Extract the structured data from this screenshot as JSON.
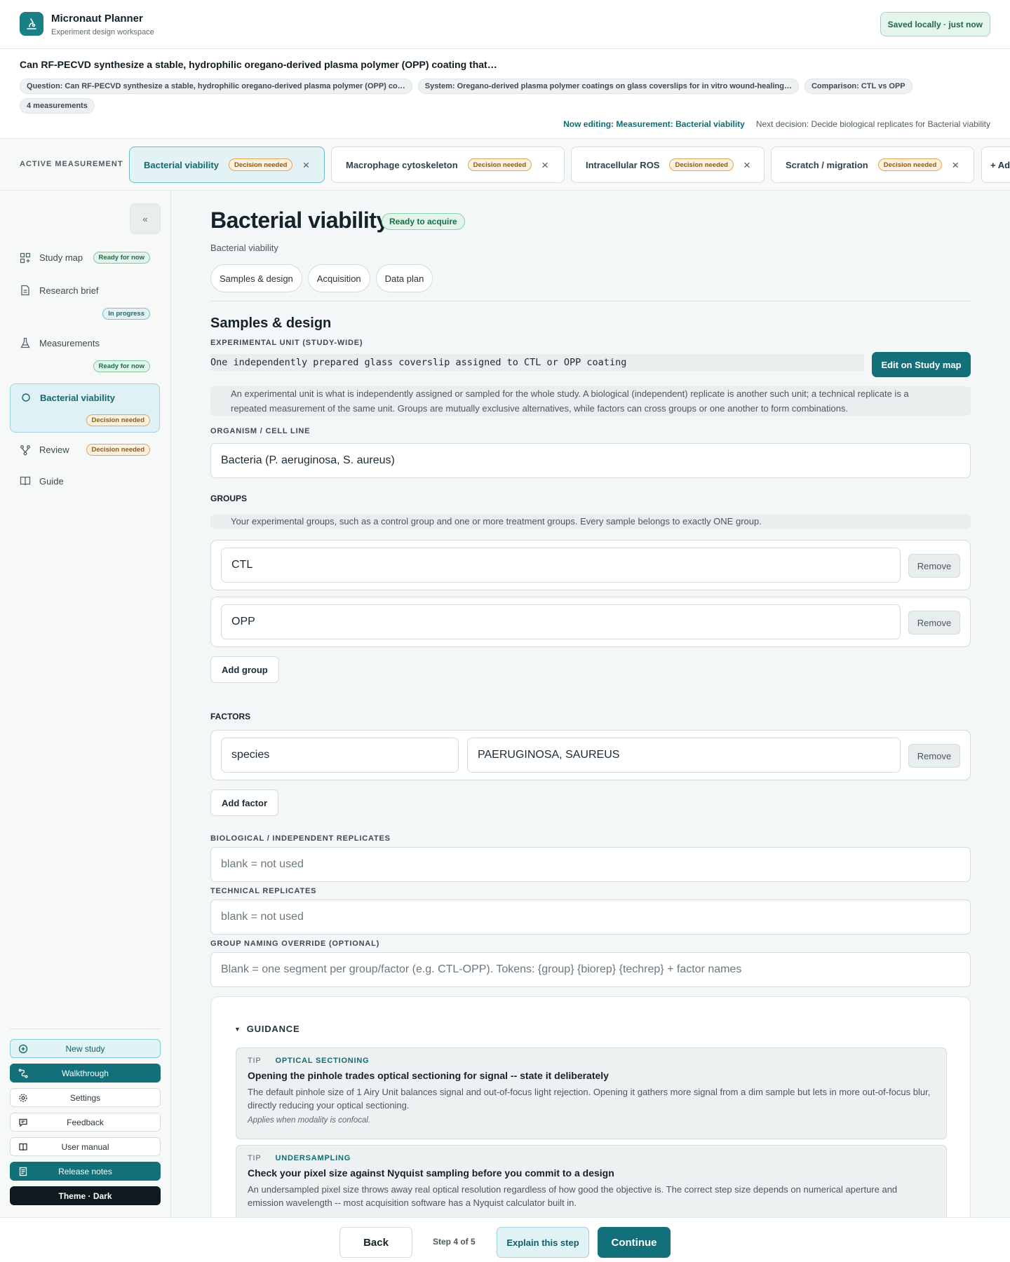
{
  "header": {
    "app_title": "Micronaut Planner",
    "app_subtitle": "Experiment design workspace",
    "saved_status": "Saved locally · just now"
  },
  "study": {
    "question": "Can RF-PECVD synthesize a stable, hydrophilic oregano-derived plasma polymer (OPP) coating that…",
    "chips": [
      "Question: Can RF-PECVD synthesize a stable, hydrophilic oregano-derived plasma polymer (OPP) co…",
      "System: Oregano-derived plasma polymer coatings on glass coverslips for in vitro wound-healing…",
      "Comparison: CTL vs OPP",
      "4 measurements"
    ],
    "now_editing": "Now editing: Measurement: Bacterial viability",
    "next_decision": "Next decision: Decide biological replicates for Bacterial viability"
  },
  "measurements_bar": {
    "label": "ACTIVE MEASUREMENT",
    "tabs": [
      {
        "label": "Bacterial viability",
        "badge": "Decision needed"
      },
      {
        "label": "Macrophage cytoskeleton",
        "badge": "Decision needed"
      },
      {
        "label": "Intracellular ROS",
        "badge": "Decision needed"
      },
      {
        "label": "Scratch / migration",
        "badge": "Decision needed"
      }
    ],
    "add_label": "+ Add"
  },
  "sidebar": {
    "collapse_label": "«",
    "items": [
      {
        "label": "Study map",
        "badge": "Ready for now",
        "icon": "grid-plus-icon"
      },
      {
        "label": "Research brief",
        "badge": "In progress",
        "icon": "document-icon"
      },
      {
        "label": "Measurements",
        "badge": "Ready for now",
        "icon": "flask-icon"
      },
      {
        "label": "Bacterial viability",
        "badge": "Decision needed",
        "icon": "circle-icon"
      },
      {
        "label": "Review",
        "badge": "Decision needed",
        "icon": "branch-icon"
      },
      {
        "label": "Guide",
        "icon": "book-icon"
      }
    ],
    "buttons": {
      "new_study": "New study",
      "walkthrough": "Walkthrough",
      "settings": "Settings",
      "feedback": "Feedback",
      "user_manual": "User manual",
      "release_notes": "Release notes",
      "theme": "Theme · Dark"
    }
  },
  "main": {
    "title": "Bacterial viability",
    "status_badge": "Ready to acquire",
    "subtitle": "Bacterial viability",
    "section_tabs": [
      "Samples & design",
      "Acquisition",
      "Data plan"
    ],
    "section_heading": "Samples & design",
    "experimental_unit": {
      "label": "EXPERIMENTAL UNIT (STUDY-WIDE)",
      "value": "One independently prepared glass coverslip assigned to CTL or OPP coating",
      "edit_button": "Edit on Study map",
      "help": "An experimental unit is what is independently assigned or sampled for the whole study. A biological (independent) replicate is another such unit; a technical replicate is a repeated measurement of the same unit. Groups are mutually exclusive alternatives, while factors can cross groups or one another to form combinations."
    },
    "organism": {
      "label": "ORGANISM / CELL LINE",
      "value": "Bacteria (P. aeruginosa, S. aureus)"
    },
    "groups": {
      "heading": "GROUPS",
      "help": "Your experimental groups, such as a control group and one or more treatment groups. Every sample belongs to exactly ONE group.",
      "items": [
        "CTL",
        "OPP"
      ],
      "remove_label": "Remove",
      "add_label": "Add group"
    },
    "factors": {
      "heading": "FACTORS",
      "items": [
        {
          "name": "species",
          "levels": "PAERUGINOSA, SAUREUS"
        }
      ],
      "remove_label": "Remove",
      "add_label": "Add factor"
    },
    "bio_replicates": {
      "label": "BIOLOGICAL / INDEPENDENT REPLICATES",
      "placeholder": "blank = not used"
    },
    "tech_replicates": {
      "label": "TECHNICAL REPLICATES",
      "placeholder": "blank = not used"
    },
    "naming_override": {
      "label": "GROUP NAMING OVERRIDE (OPTIONAL)",
      "placeholder": "Blank = one segment per group/factor (e.g. CTL-OPP). Tokens: {group} {biorep} {techrep} + factor names"
    },
    "guidance": {
      "heading": "GUIDANCE",
      "toggle": "▼",
      "tips": [
        {
          "tag": "TIP",
          "topic": "OPTICAL SECTIONING",
          "title": "Opening the pinhole trades optical sectioning for signal -- state it deliberately",
          "body": "The default pinhole size of 1 Airy Unit balances signal and out-of-focus light rejection. Opening it gathers more signal from a dim sample but lets in more out-of-focus blur, directly reducing your optical sectioning.",
          "note": "Applies when modality is confocal."
        },
        {
          "tag": "TIP",
          "topic": "UNDERSAMPLING",
          "title": "Check your pixel size against Nyquist sampling before you commit to a design",
          "body": "An undersampled pixel size throws away real optical resolution regardless of how good the objective is. The correct step size depends on numerical aperture and emission wavelength -- most acquisition software has a Nyquist calculator built in."
        }
      ]
    }
  },
  "footer": {
    "back": "Back",
    "step": "Step 4 of 5",
    "explain": "Explain this step",
    "continue": "Continue"
  }
}
